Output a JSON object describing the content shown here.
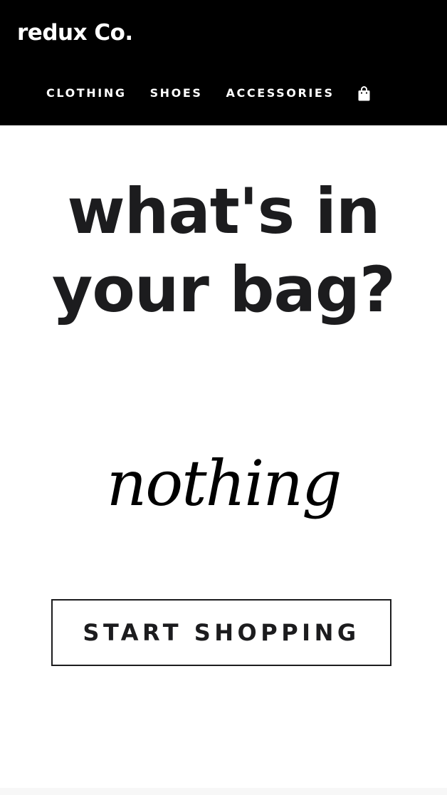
{
  "header": {
    "brand": "redux Co.",
    "nav": [
      {
        "label": "CLOTHING"
      },
      {
        "label": "SHOES"
      },
      {
        "label": "ACCESSORIES"
      }
    ],
    "cart_icon": "shopping-bag-icon"
  },
  "main": {
    "headline_line1": "what's in",
    "headline_line2": "your bag?",
    "empty_text": "nothing",
    "cta_label": "START SHOPPING"
  },
  "colors": {
    "header_bg": "#000000",
    "text_dark": "#1c1c1e",
    "background": "#ffffff"
  }
}
